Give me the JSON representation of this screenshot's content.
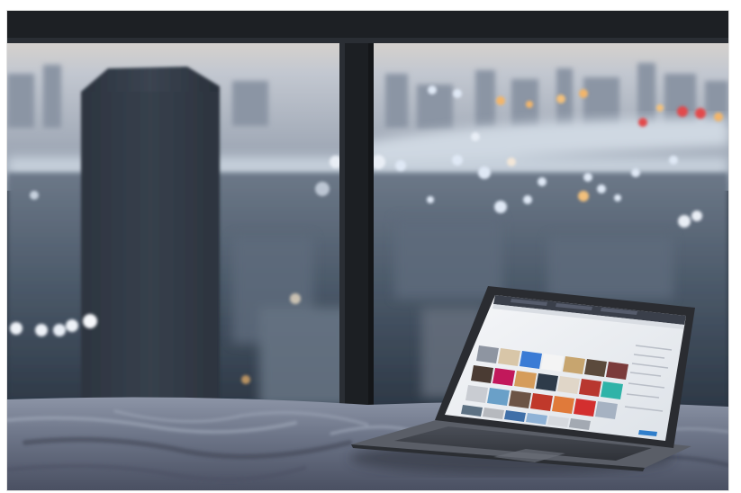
{
  "photo": {
    "subject": "laptop-on-bed-by-window",
    "colors": {
      "sky": "#b9c0cc",
      "sky_glow": "#e8d7c4",
      "city": "#4a5868",
      "city_dark": "#2d3846",
      "tower": "#333c48",
      "river": "#c9d3de",
      "window_frame": "#1d2024",
      "bed_sheet": "#6e7689",
      "bed_shadow": "#3e4454",
      "laptop_body": "#3a3d44",
      "laptop_screen": "#eef1f4",
      "bokeh_warm": "#f2b56b",
      "bokeh_red": "#e2484b",
      "bokeh_cool": "#dfe8f5"
    }
  }
}
